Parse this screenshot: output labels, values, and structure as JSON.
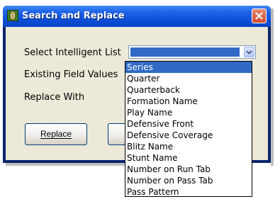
{
  "window": {
    "title": "Search and Replace"
  },
  "form": {
    "select_list_label": "Select Intelligent List",
    "existing_values_label": "Existing Field Values",
    "replace_with_label": "Replace With",
    "selected_value": ""
  },
  "buttons": {
    "replace_label": "Replace",
    "second_label": ""
  },
  "dropdown": {
    "items": [
      "Series",
      "Quarter",
      "Quarterback",
      "Formation Name",
      "Play Name",
      "Defensive Front",
      "Defensive Coverage",
      "Blitz Name",
      "Stunt Name",
      "Number on Run Tab",
      "Number on Pass Tab",
      "Pass Pattern"
    ],
    "highlighted": "Series"
  },
  "colors": {
    "titlebar": "#0b4ed6",
    "selection": "#316ac5",
    "dialog_bg": "#ece9d8",
    "close_button": "#d1482c"
  },
  "icons": {
    "app": "football-icon",
    "close": "close-icon",
    "dropdown": "chevron-down-icon"
  }
}
